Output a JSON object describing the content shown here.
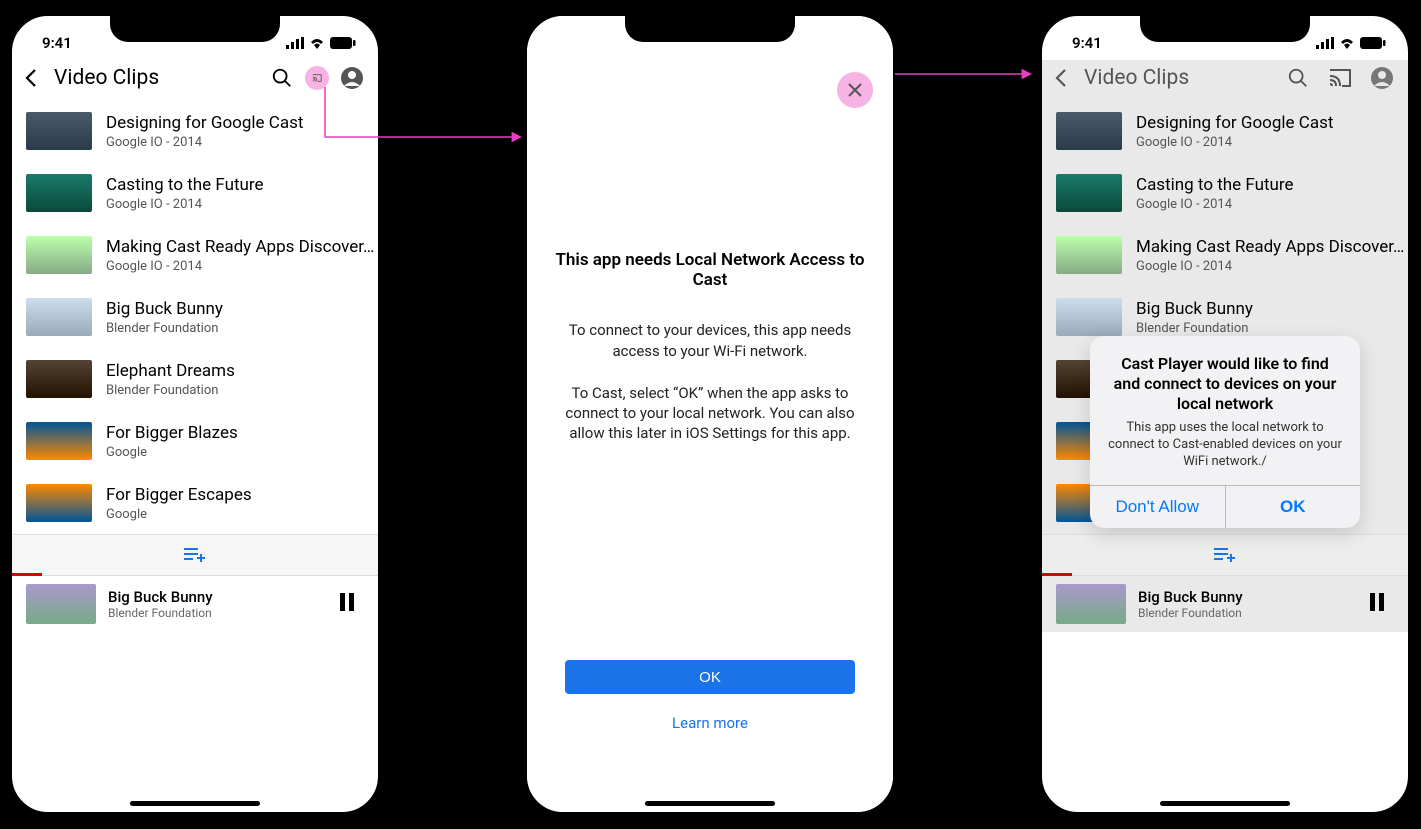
{
  "status": {
    "time": "9:41"
  },
  "header": {
    "title": "Video Clips"
  },
  "videos": [
    {
      "title": "Designing for Google Cast",
      "sub": "Google IO - 2014"
    },
    {
      "title": "Casting to the Future",
      "sub": "Google IO - 2014"
    },
    {
      "title": "Making Cast Ready Apps Discover...",
      "sub": "Google IO - 2014"
    },
    {
      "title": "Big Buck Bunny",
      "sub": "Blender Foundation"
    },
    {
      "title": "Elephant Dreams",
      "sub": "Blender Foundation"
    },
    {
      "title": "For Bigger Blazes",
      "sub": "Google"
    },
    {
      "title": "For Bigger Escapes",
      "sub": "Google"
    }
  ],
  "now_playing": {
    "title": "Big Buck Bunny",
    "sub": "Blender Foundation"
  },
  "modal": {
    "title": "This app needs Local Network Access to Cast",
    "para1": "To connect to your devices, this app needs access to your Wi-Fi network.",
    "para2": "To Cast, select “OK” when the app asks to connect to your local network. You can also allow this later in iOS Settings for this app.",
    "ok": "OK",
    "learn_more": "Learn more"
  },
  "alert": {
    "title": "Cast Player would like to find and connect to devices on your local network",
    "message": "This app uses the local network to connect to Cast-enabled devices on your WiFi network./",
    "dont_allow": "Don't Allow",
    "ok": "OK"
  }
}
